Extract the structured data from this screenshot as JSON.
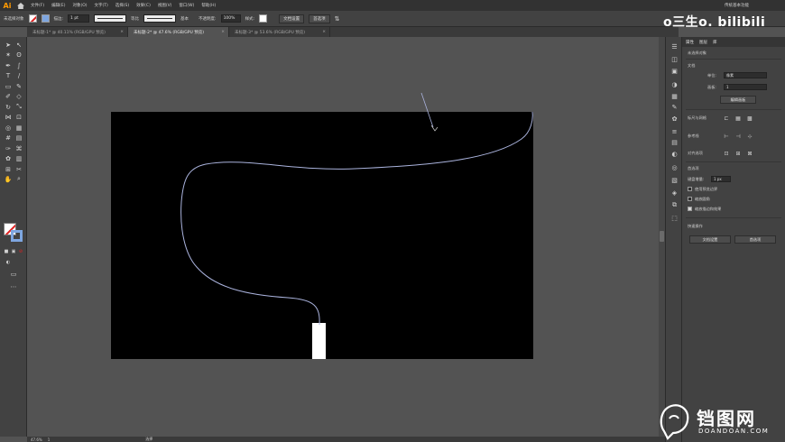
{
  "app": {
    "logo": "Ai"
  },
  "menubar": {
    "items": [
      "文件(F)",
      "编辑(E)",
      "对象(O)",
      "文字(T)",
      "选择(S)",
      "效果(C)",
      "视图(V)",
      "窗口(W)",
      "帮助(H)"
    ],
    "workspace": "传统基本功能"
  },
  "controlbar": {
    "selection_label": "未选择对象",
    "stroke_label": "描边:",
    "stroke_value": "1 pt",
    "brush_label": "等比",
    "basic_label": "基本",
    "opacity_label": "不透明度:",
    "opacity_value": "100%",
    "style_label": "样式:",
    "doc_setup": "文档设置",
    "preferences": "首选项"
  },
  "tabs": [
    {
      "label": "未标题-1* @ 40.11% (RGB/GPU 预览)",
      "active": false
    },
    {
      "label": "未标题-2* @ 47.6% (RGB/GPU 预览)",
      "active": true
    },
    {
      "label": "未标题-3* @ 53.6% (RGB/GPU 预览)",
      "active": false
    }
  ],
  "statusbar": {
    "zoom": "47.6%",
    "page": "1",
    "state": "选择"
  },
  "panel": {
    "tabs": [
      "属性",
      "图层",
      "库"
    ],
    "no_selection": "未选择对象",
    "document_section": "文档",
    "units_label": "单位:",
    "units_value": "像素",
    "artboard_label": "画板:",
    "artboard_value": "1",
    "edit_artboard_btn": "编辑画板",
    "rulers_grid": "标尺与网格",
    "guides": "参考线",
    "snap": "对齐选项",
    "preferences_section": "首选项",
    "keyboard_increment_label": "键盘增量:",
    "keyboard_increment_value": "1 px",
    "cb_preview_bounds": "使用预览边界",
    "cb_scale_corners": "缩放圆角",
    "cb_scale_strokes": "缩放描边和效果",
    "quick_actions": "快速操作",
    "doc_setup_btn": "文档设置",
    "preferences_btn": "首选项"
  },
  "watermark": {
    "top": "o三生o. bilibili",
    "bottom_cn": "铛图网",
    "bottom_en": "DOANDOAN.COM"
  },
  "colors": {
    "accent_path": "#9aa8d6",
    "fill_none": "#ffffff",
    "stroke_blue": "#7ea6e0",
    "logo_orange": "#ff9a00"
  }
}
